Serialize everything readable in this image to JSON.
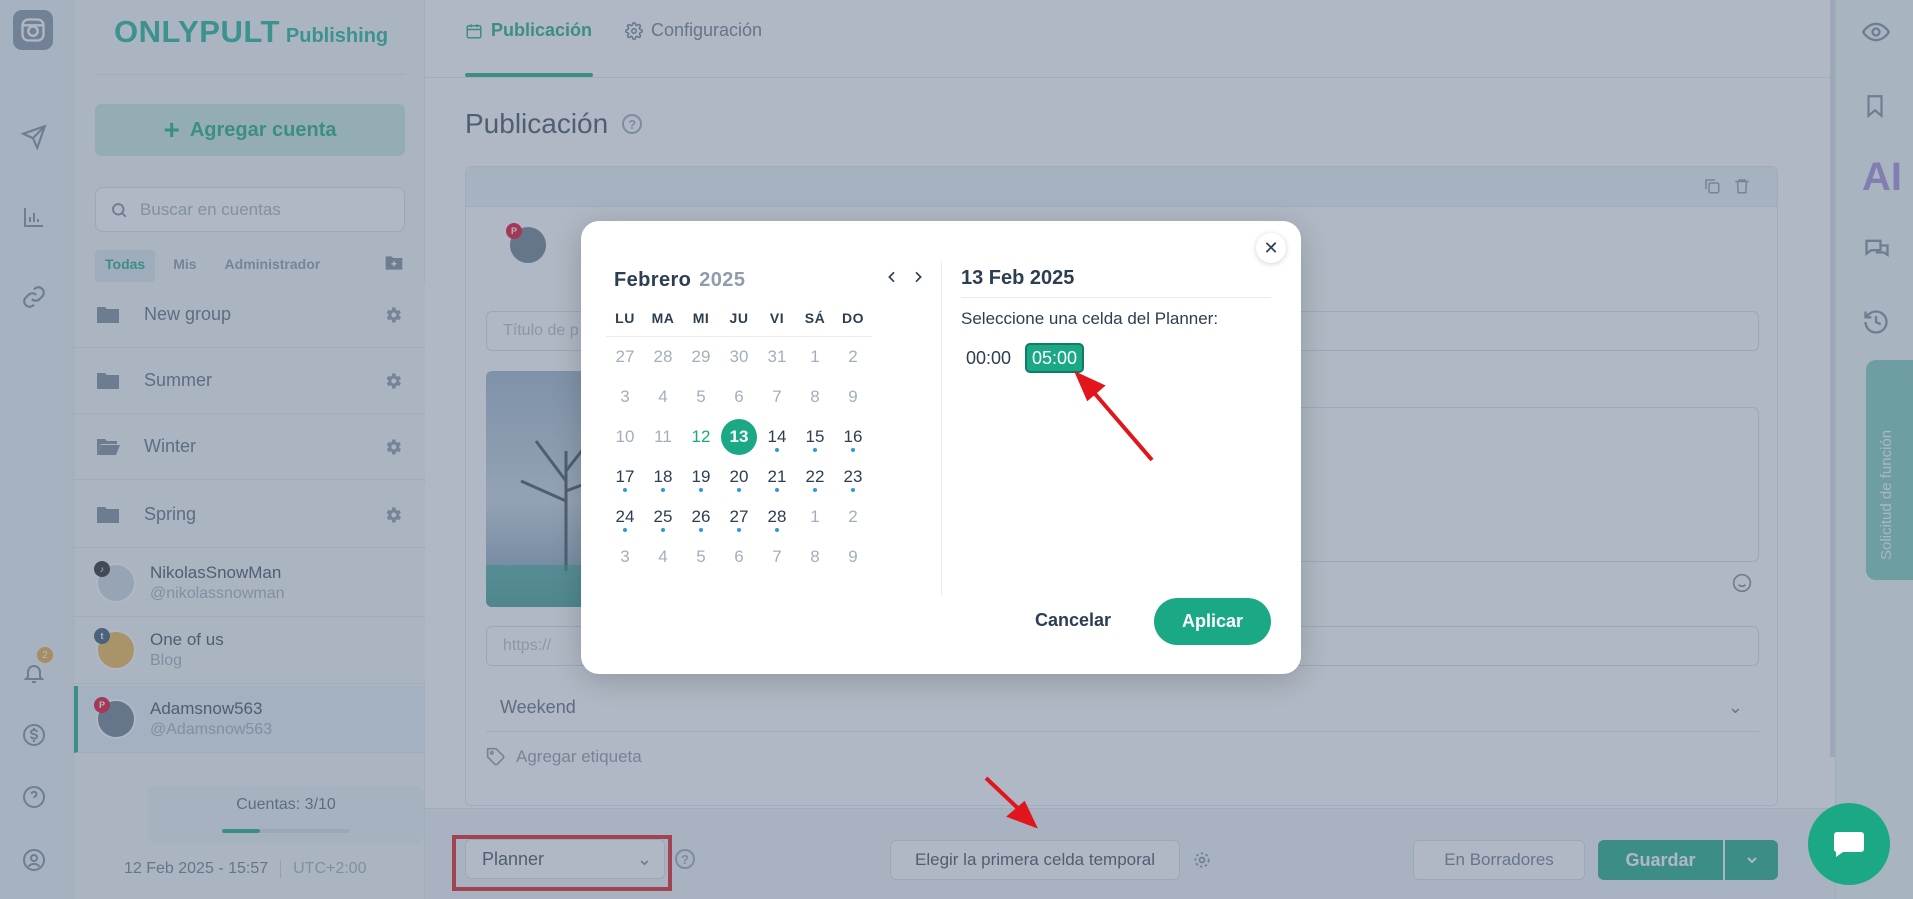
{
  "brand": {
    "name": "ONLYPULT",
    "sub": "Publishing"
  },
  "sidebar": {
    "add_account": "Agregar cuenta",
    "search_placeholder": "Buscar en cuentas",
    "filters": [
      "Todas",
      "Mis",
      "Administrador"
    ],
    "groups": [
      "New group",
      "Summer",
      "Winter",
      "Spring"
    ],
    "accounts": [
      {
        "name": "NikolasSnowMan",
        "handle": "@nikolassnowman",
        "network": "tiktok"
      },
      {
        "name": "One of us",
        "handle": "Blog",
        "network": "tumblr"
      },
      {
        "name": "Adamsnow563",
        "handle": "@Adamsnow563",
        "network": "pinterest"
      }
    ],
    "quota_label": "Cuentas: 3/10",
    "quota_fraction": 0.3,
    "datetime": "12 Feb 2025 - 15:57",
    "timezone": "UTC+2:00",
    "notif_count": "2"
  },
  "tabs": {
    "publication": "Publicación",
    "settings": "Configuración"
  },
  "page": {
    "title": "Publicación",
    "title_placeholder": "Título de p",
    "link_placeholder": "https://",
    "category": "Weekend",
    "tag_placeholder": "Agregar etiqueta"
  },
  "right_rail": {
    "ai": "AI",
    "feature_request": "Solicitud de función"
  },
  "bottom": {
    "mode": "Planner",
    "first_cell": "Elegir la primera celda temporal",
    "drafts": "En Borradores",
    "save": "Guardar"
  },
  "modal": {
    "month": "Febrero",
    "year": "2025",
    "weekdays": [
      "LU",
      "MA",
      "MI",
      "JU",
      "VI",
      "SÁ",
      "DO"
    ],
    "weeks": [
      [
        "27",
        "28",
        "29",
        "30",
        "31",
        "1",
        "2"
      ],
      [
        "3",
        "4",
        "5",
        "6",
        "7",
        "8",
        "9"
      ],
      [
        "10",
        "11",
        "12",
        "13",
        "14",
        "15",
        "16"
      ],
      [
        "17",
        "18",
        "19",
        "20",
        "21",
        "22",
        "23"
      ],
      [
        "24",
        "25",
        "26",
        "27",
        "28",
        "1",
        "2"
      ],
      [
        "3",
        "4",
        "5",
        "6",
        "7",
        "8",
        "9"
      ]
    ],
    "selected_date": "13 Feb 2025",
    "instruction": "Seleccione una celda del Planner:",
    "slots": [
      "00:00",
      "05:00"
    ],
    "cancel": "Cancelar",
    "apply": "Aplicar"
  },
  "colors": {
    "accent": "#1aa885",
    "annotation": "#e1151b"
  }
}
